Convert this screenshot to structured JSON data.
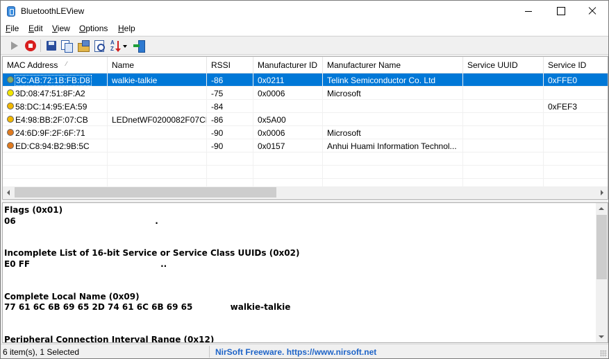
{
  "window": {
    "title": "BluetoothLEView"
  },
  "menu": [
    {
      "label": "File",
      "underline": "F",
      "rest": "ile"
    },
    {
      "label": "Edit",
      "underline": "E",
      "rest": "dit"
    },
    {
      "label": "View",
      "underline": "V",
      "rest": "iew"
    },
    {
      "label": "Options",
      "underline": "O",
      "rest": "ptions"
    },
    {
      "label": "Help",
      "underline": "H",
      "rest": "elp"
    }
  ],
  "toolbar": {
    "icons": [
      "play-icon",
      "stop-icon",
      "save-icon",
      "copy-icon",
      "properties-icon",
      "find-icon",
      "sort-icon",
      "exit-icon"
    ]
  },
  "list": {
    "columns": [
      "MAC Address",
      "Name",
      "RSSI",
      "Manufacturer ID",
      "Manufacturer Name",
      "Service UUID",
      "Service ID"
    ],
    "sort_column": "MAC Address",
    "rows": [
      {
        "mac": "3C:AB:72:1B:FB:D8",
        "name": "walkie-talkie",
        "rssi": "-86",
        "mfid": "0x0211",
        "mfname": "Telink Semiconductor Co. Ltd",
        "svcuuid": "",
        "svcid": "0xFFE0",
        "dot_color": "#7fae6e",
        "selected": true
      },
      {
        "mac": "3D:08:47:51:8F:A2",
        "name": "",
        "rssi": "-75",
        "mfid": "0x0006",
        "mfname": "Microsoft",
        "svcuuid": "",
        "svcid": "",
        "dot_color": "#f2e600",
        "selected": false
      },
      {
        "mac": "58:DC:14:95:EA:59",
        "name": "",
        "rssi": "-84",
        "mfid": "",
        "mfname": "",
        "svcuuid": "",
        "svcid": "0xFEF3",
        "dot_color": "#f2b800",
        "selected": false
      },
      {
        "mac": "E4:98:BB:2F:07:CB",
        "name": "LEDnetWF0200082F07CB",
        "rssi": "-86",
        "mfid": "0x5A00",
        "mfname": "",
        "svcuuid": "",
        "svcid": "",
        "dot_color": "#f2b800",
        "selected": false
      },
      {
        "mac": "24:6D:9F:2F:6F:71",
        "name": "",
        "rssi": "-90",
        "mfid": "0x0006",
        "mfname": "Microsoft",
        "svcuuid": "",
        "svcid": "",
        "dot_color": "#e07a1e",
        "selected": false
      },
      {
        "mac": "ED:C8:94:B2:9B:5C",
        "name": "",
        "rssi": "-90",
        "mfid": "0x0157",
        "mfname": "Anhui Huami Information Technol...",
        "svcuuid": "",
        "svcid": "",
        "dot_color": "#e07a1e",
        "selected": false
      }
    ]
  },
  "detail": {
    "lines": [
      {
        "text": "Flags (0x01)",
        "bold": true
      },
      {
        "text": "06                                                .",
        "bold": true
      },
      {
        "text": "",
        "bold": false
      },
      {
        "text": "",
        "bold": false
      },
      {
        "text": "Incomplete List of 16-bit Service or Service Class UUIDs (0x02)",
        "bold": true
      },
      {
        "text": "E0 FF                                             ..",
        "bold": true
      },
      {
        "text": "",
        "bold": false
      },
      {
        "text": "",
        "bold": false
      },
      {
        "text": "Complete Local Name (0x09)",
        "bold": true
      },
      {
        "text": "77 61 6C 6B 69 65 2D 74 61 6C 6B 69 65             walkie-talkie",
        "bold": true
      },
      {
        "text": "",
        "bold": false
      },
      {
        "text": "",
        "bold": false
      },
      {
        "text": "Peripheral Connection Interval Range (0x12)",
        "bold": true
      }
    ]
  },
  "status": {
    "items": "6 item(s), 1 Selected",
    "link": "NirSoft Freeware. https://www.nirsoft.net",
    "link_color": "#1e64c8"
  },
  "colors": {
    "selection": "#0078d7"
  }
}
